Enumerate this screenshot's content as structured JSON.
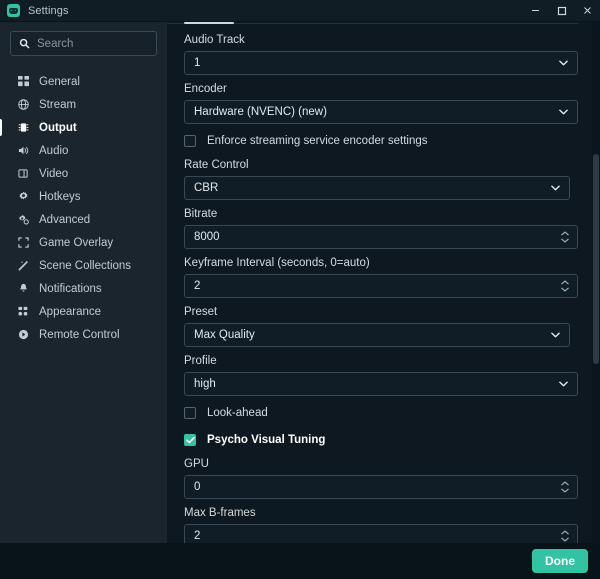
{
  "window": {
    "title": "Settings",
    "app_icon": "streamlabs-icon",
    "controls": [
      {
        "name": "minimize-button",
        "icon": "minimize-icon"
      },
      {
        "name": "maximize-button",
        "icon": "maximize-icon"
      },
      {
        "name": "close-button",
        "icon": "close-icon"
      }
    ]
  },
  "sidebar": {
    "search": {
      "value": "",
      "placeholder": "Search",
      "icon": "search-icon"
    },
    "items": [
      {
        "label": "General",
        "icon": "grid-icon",
        "active": false
      },
      {
        "label": "Stream",
        "icon": "globe-icon",
        "active": false
      },
      {
        "label": "Output",
        "icon": "chip-icon",
        "active": true
      },
      {
        "label": "Audio",
        "icon": "speaker-icon",
        "active": false
      },
      {
        "label": "Video",
        "icon": "monitor-icon",
        "active": false
      },
      {
        "label": "Hotkeys",
        "icon": "gear-icon",
        "active": false
      },
      {
        "label": "Advanced",
        "icon": "gears-icon",
        "active": false
      },
      {
        "label": "Game Overlay",
        "icon": "expand-icon",
        "active": false
      },
      {
        "label": "Scene Collections",
        "icon": "wand-icon",
        "active": false
      },
      {
        "label": "Notifications",
        "icon": "bell-icon",
        "active": false
      },
      {
        "label": "Appearance",
        "icon": "layout-icon",
        "active": false
      },
      {
        "label": "Remote Control",
        "icon": "play-circle-icon",
        "active": false
      }
    ]
  },
  "main": {
    "fields": {
      "audio_track": {
        "label": "Audio Track",
        "value": "1"
      },
      "encoder": {
        "label": "Encoder",
        "value": "Hardware (NVENC) (new)"
      },
      "enforce": {
        "label": "Enforce streaming service encoder settings",
        "checked": false
      },
      "rate_control": {
        "label": "Rate Control",
        "value": "CBR"
      },
      "bitrate": {
        "label": "Bitrate",
        "value": "8000"
      },
      "keyframe_interval": {
        "label": "Keyframe Interval (seconds, 0=auto)",
        "value": "2"
      },
      "preset": {
        "label": "Preset",
        "value": "Max Quality"
      },
      "profile": {
        "label": "Profile",
        "value": "high"
      },
      "look_ahead": {
        "label": "Look-ahead",
        "checked": false
      },
      "psycho_visual": {
        "label": "Psycho Visual Tuning",
        "checked": true
      },
      "gpu": {
        "label": "GPU",
        "value": "0"
      },
      "max_b_frames": {
        "label": "Max B-frames",
        "value": "2"
      }
    }
  },
  "footer": {
    "done_label": "Done"
  },
  "colors": {
    "accent": "#31c3a2",
    "sidebar_bg": "#1a252d",
    "content_bg": "#0d1820",
    "window_bg": "#09131a",
    "field_border": "#3a4853"
  }
}
